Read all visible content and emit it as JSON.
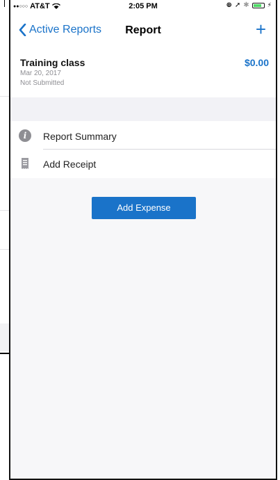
{
  "status_bar": {
    "carrier": "AT&T",
    "time": "2:05 PM"
  },
  "nav": {
    "back_label": "Active Reports",
    "title": "Report",
    "add_label": "+"
  },
  "report": {
    "name": "Training class",
    "amount": "$0.00",
    "date": "Mar 20, 2017",
    "status": "Not Submitted"
  },
  "menu": {
    "summary_label": "Report Summary",
    "receipt_label": "Add Receipt"
  },
  "actions": {
    "add_expense_label": "Add Expense"
  },
  "colors": {
    "accent": "#1a73c9",
    "band": "#f2f2f6",
    "secondary_text": "#8e8e93"
  }
}
